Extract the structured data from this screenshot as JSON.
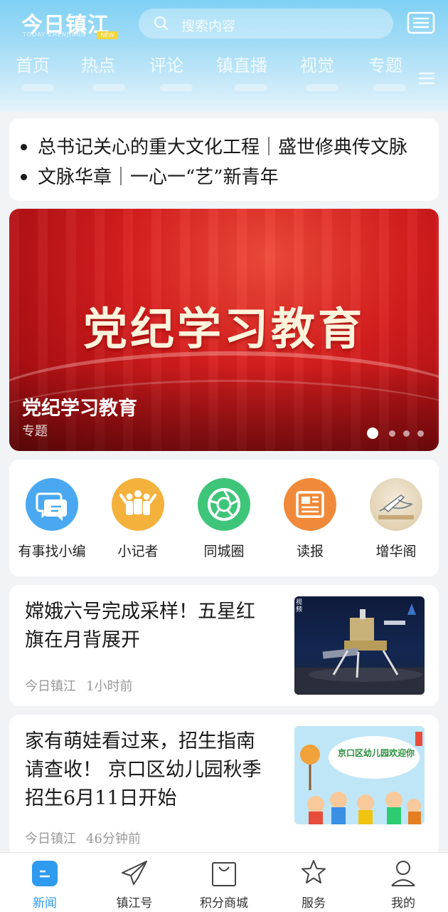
{
  "header": {
    "logo_text": "今日镇江",
    "logo_sub": "TODAY ZHENJIANG",
    "logo_badge": "NEW",
    "search_placeholder": "搜索内容",
    "tabs": [
      "首页",
      "热点",
      "评论",
      "镇直播",
      "视觉",
      "专题"
    ]
  },
  "headlines": [
    "总书记关心的重大文化工程｜盛世修典传文脉",
    "文脉华章｜一心一“艺”新青年"
  ],
  "banner": {
    "big_text": "党纪学习教育",
    "title": "党纪学习教育",
    "subtitle": "专题",
    "slide_index": 1,
    "slide_count": 4
  },
  "quick_links": [
    {
      "label": "有事找小编",
      "color": "#4aa8f0",
      "icon": "chat-icon"
    },
    {
      "label": "小记者",
      "color": "#f4b13b",
      "icon": "kids-icon"
    },
    {
      "label": "同城圈",
      "color": "#3fc57a",
      "icon": "aperture-icon"
    },
    {
      "label": "读报",
      "color": "#f08a3a",
      "icon": "newspaper-icon"
    },
    {
      "label": "增华阁",
      "color": "#e9dcc6",
      "icon": "pen-icon"
    }
  ],
  "news": [
    {
      "title_lines": [
        "嫦娥六号完成采样！五星红",
        "旗在月背展开"
      ],
      "source": "今日镇江",
      "time": "1小时前",
      "thumb_label": "视频"
    },
    {
      "title_lines": [
        "家有萌娃看过来，招生指南",
        "请查收！ 京口区幼儿园秋季",
        "招生6月11日开始"
      ],
      "source": "今日镇江",
      "time": "46分钟前",
      "thumb_label": "京口区幼儿园欢迎你"
    }
  ],
  "bottom_nav": [
    {
      "label": "新闻",
      "icon": "news-icon",
      "active": true
    },
    {
      "label": "镇江号",
      "icon": "paper-plane-icon",
      "active": false
    },
    {
      "label": "积分商城",
      "icon": "shopping-bag-icon",
      "active": false
    },
    {
      "label": "服务",
      "icon": "star-icon",
      "active": false
    },
    {
      "label": "我的",
      "icon": "user-icon",
      "active": false
    }
  ]
}
